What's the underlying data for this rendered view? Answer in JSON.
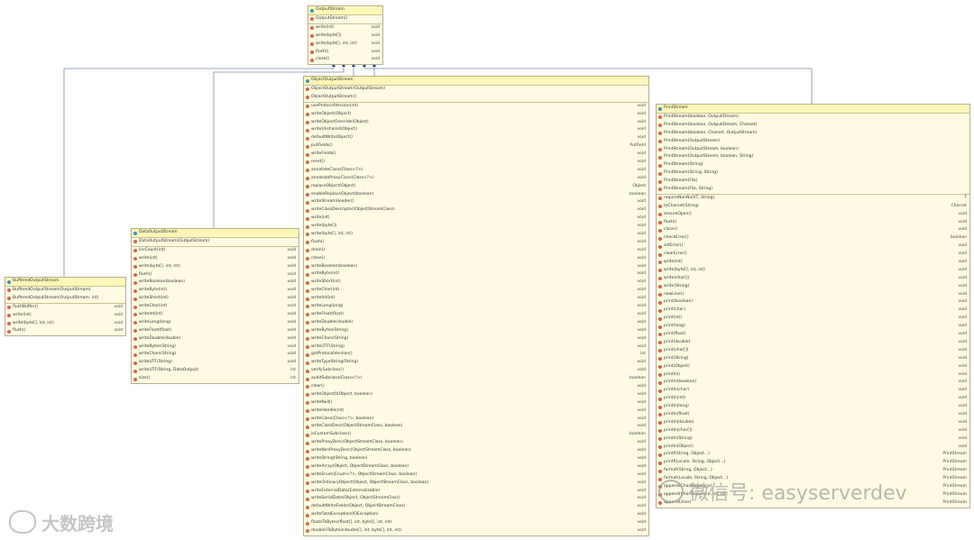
{
  "diagram": {
    "classes": {
      "output_stream": {
        "name": "OutputStream",
        "constructors": [
          "OutputStream()"
        ],
        "methods": [
          {
            "name": "write(int)",
            "ret": "void"
          },
          {
            "name": "write(byte[])",
            "ret": "void"
          },
          {
            "name": "write(byte[], int, int)",
            "ret": "void"
          },
          {
            "name": "flush()",
            "ret": "void"
          },
          {
            "name": "close()",
            "ret": "void"
          }
        ]
      },
      "object_output_stream": {
        "name": "ObjectOutputStream",
        "constructors": [
          "ObjectOutputStream(OutputStream)",
          "ObjectOutputStream()"
        ],
        "methods": [
          {
            "name": "useProtocolVersion(int)",
            "ret": "void"
          },
          {
            "name": "writeObject(Object)",
            "ret": "void"
          },
          {
            "name": "writeObjectOverride(Object)",
            "ret": "void"
          },
          {
            "name": "writeUnshared(Object)",
            "ret": "void"
          },
          {
            "name": "defaultWriteObject()",
            "ret": "void"
          },
          {
            "name": "putFields()",
            "ret": "PutField"
          },
          {
            "name": "writeFields()",
            "ret": "void"
          },
          {
            "name": "reset()",
            "ret": "void"
          },
          {
            "name": "annotateClass(Class<?>)",
            "ret": "void"
          },
          {
            "name": "annotateProxyClass(Class<?>)",
            "ret": "void"
          },
          {
            "name": "replaceObject(Object)",
            "ret": "Object"
          },
          {
            "name": "enableReplaceObject(boolean)",
            "ret": "boolean"
          },
          {
            "name": "writeStreamHeader()",
            "ret": "void"
          },
          {
            "name": "writeClassDescriptor(ObjectStreamClass)",
            "ret": "void"
          },
          {
            "name": "write(int)",
            "ret": "void"
          },
          {
            "name": "write(byte[])",
            "ret": "void"
          },
          {
            "name": "write(byte[], int, int)",
            "ret": "void"
          },
          {
            "name": "flush()",
            "ret": "void"
          },
          {
            "name": "drain()",
            "ret": "void"
          },
          {
            "name": "close()",
            "ret": "void"
          },
          {
            "name": "writeBoolean(boolean)",
            "ret": "void"
          },
          {
            "name": "writeByte(int)",
            "ret": "void"
          },
          {
            "name": "writeShort(int)",
            "ret": "void"
          },
          {
            "name": "writeChar(int)",
            "ret": "void"
          },
          {
            "name": "writeInt(int)",
            "ret": "void"
          },
          {
            "name": "writeLong(long)",
            "ret": "void"
          },
          {
            "name": "writeFloat(float)",
            "ret": "void"
          },
          {
            "name": "writeDouble(double)",
            "ret": "void"
          },
          {
            "name": "writeBytes(String)",
            "ret": "void"
          },
          {
            "name": "writeChars(String)",
            "ret": "void"
          },
          {
            "name": "writeUTF(String)",
            "ret": "void"
          },
          {
            "name": "getProtocolVersion()",
            "ret": "int"
          },
          {
            "name": "writeTypeString(String)",
            "ret": "void"
          },
          {
            "name": "verifySubclass()",
            "ret": "void"
          },
          {
            "name": "auditSubclass(Class<?>)",
            "ret": "boolean"
          },
          {
            "name": "clear()",
            "ret": "void"
          },
          {
            "name": "writeObject0(Object, boolean)",
            "ret": "void"
          },
          {
            "name": "writeNull()",
            "ret": "void"
          },
          {
            "name": "writeHandle(int)",
            "ret": "void"
          },
          {
            "name": "writeClass(Class<?>, boolean)",
            "ret": "void"
          },
          {
            "name": "writeClassDesc(ObjectStreamClass, boolean)",
            "ret": "void"
          },
          {
            "name": "isCustomSubclass()",
            "ret": "boolean"
          },
          {
            "name": "writeProxyDesc(ObjectStreamClass, boolean)",
            "ret": "void"
          },
          {
            "name": "writeNonProxyDesc(ObjectStreamClass, boolean)",
            "ret": "void"
          },
          {
            "name": "writeString(String, boolean)",
            "ret": "void"
          },
          {
            "name": "writeArray(Object, ObjectStreamClass, boolean)",
            "ret": "void"
          },
          {
            "name": "writeEnum(Enum<?>, ObjectStreamClass, boolean)",
            "ret": "void"
          },
          {
            "name": "writeOrdinaryObject(Object, ObjectStreamClass, boolean)",
            "ret": "void"
          },
          {
            "name": "writeExternalData(Externalizable)",
            "ret": "void"
          },
          {
            "name": "writeSerialData(Object, ObjectStreamClass)",
            "ret": "void"
          },
          {
            "name": "defaultWriteFields(Object, ObjectStreamClass)",
            "ret": "void"
          },
          {
            "name": "writeFatalException(IOException)",
            "ret": "void"
          },
          {
            "name": "floatsToBytes(float[], int, byte[], int, int)",
            "ret": "void"
          },
          {
            "name": "doublesToBytes(double[], int, byte[], int, int)",
            "ret": "void"
          }
        ]
      },
      "print_stream": {
        "name": "PrintStream",
        "constructors": [
          "PrintStream(boolean, OutputStream)",
          "PrintStream(boolean, OutputStream, Charset)",
          "PrintStream(boolean, Charset, OutputStream)",
          "PrintStream(OutputStream)",
          "PrintStream(OutputStream, boolean)",
          "PrintStream(OutputStream, boolean, String)",
          "PrintStream(String)",
          "PrintStream(String, String)",
          "PrintStream(File)",
          "PrintStream(File, String)"
        ],
        "methods": [
          {
            "name": "requireNonNull(T, String)",
            "ret": "T"
          },
          {
            "name": "toCharset(String)",
            "ret": "Charset"
          },
          {
            "name": "ensureOpen()",
            "ret": "void"
          },
          {
            "name": "flush()",
            "ret": "void"
          },
          {
            "name": "close()",
            "ret": "void"
          },
          {
            "name": "checkError()",
            "ret": "boolean"
          },
          {
            "name": "setError()",
            "ret": "void"
          },
          {
            "name": "clearError()",
            "ret": "void"
          },
          {
            "name": "write(int)",
            "ret": "void"
          },
          {
            "name": "write(byte[], int, int)",
            "ret": "void"
          },
          {
            "name": "write(char[])",
            "ret": "void"
          },
          {
            "name": "write(String)",
            "ret": "void"
          },
          {
            "name": "newLine()",
            "ret": "void"
          },
          {
            "name": "print(boolean)",
            "ret": "void"
          },
          {
            "name": "print(char)",
            "ret": "void"
          },
          {
            "name": "print(int)",
            "ret": "void"
          },
          {
            "name": "print(long)",
            "ret": "void"
          },
          {
            "name": "print(float)",
            "ret": "void"
          },
          {
            "name": "print(double)",
            "ret": "void"
          },
          {
            "name": "print(char[])",
            "ret": "void"
          },
          {
            "name": "print(String)",
            "ret": "void"
          },
          {
            "name": "print(Object)",
            "ret": "void"
          },
          {
            "name": "println()",
            "ret": "void"
          },
          {
            "name": "println(boolean)",
            "ret": "void"
          },
          {
            "name": "println(char)",
            "ret": "void"
          },
          {
            "name": "println(int)",
            "ret": "void"
          },
          {
            "name": "println(long)",
            "ret": "void"
          },
          {
            "name": "println(float)",
            "ret": "void"
          },
          {
            "name": "println(double)",
            "ret": "void"
          },
          {
            "name": "println(char[])",
            "ret": "void"
          },
          {
            "name": "println(String)",
            "ret": "void"
          },
          {
            "name": "println(Object)",
            "ret": "void"
          },
          {
            "name": "printf(String, Object...)",
            "ret": "PrintStream"
          },
          {
            "name": "printf(Locale, String, Object...)",
            "ret": "PrintStream"
          },
          {
            "name": "format(String, Object...)",
            "ret": "PrintStream"
          },
          {
            "name": "format(Locale, String, Object...)",
            "ret": "PrintStream"
          },
          {
            "name": "append(CharSequence)",
            "ret": "PrintStream"
          },
          {
            "name": "append(CharSequence, int, int)",
            "ret": "PrintStream"
          },
          {
            "name": "append(char)",
            "ret": "PrintStream"
          }
        ]
      },
      "data_output_stream": {
        "name": "DataOutputStream",
        "constructors": [
          "DataOutputStream(OutputStream)"
        ],
        "methods": [
          {
            "name": "incCount(int)",
            "ret": "void"
          },
          {
            "name": "write(int)",
            "ret": "void"
          },
          {
            "name": "write(byte[], int, int)",
            "ret": "void"
          },
          {
            "name": "flush()",
            "ret": "void"
          },
          {
            "name": "writeBoolean(boolean)",
            "ret": "void"
          },
          {
            "name": "writeByte(int)",
            "ret": "void"
          },
          {
            "name": "writeShort(int)",
            "ret": "void"
          },
          {
            "name": "writeChar(int)",
            "ret": "void"
          },
          {
            "name": "writeInt(int)",
            "ret": "void"
          },
          {
            "name": "writeLong(long)",
            "ret": "void"
          },
          {
            "name": "writeFloat(float)",
            "ret": "void"
          },
          {
            "name": "writeDouble(double)",
            "ret": "void"
          },
          {
            "name": "writeBytes(String)",
            "ret": "void"
          },
          {
            "name": "writeChars(String)",
            "ret": "void"
          },
          {
            "name": "writeUTF(String)",
            "ret": "void"
          },
          {
            "name": "writeUTF(String, DataOutput)",
            "ret": "int"
          },
          {
            "name": "size()",
            "ret": "int"
          }
        ]
      },
      "buffered_output_stream": {
        "name": "BufferedOutputStream",
        "constructors": [
          "BufferedOutputStream(OutputStream)",
          "BufferedOutputStream(OutputStream, int)"
        ],
        "methods": [
          {
            "name": "flushBuffer()",
            "ret": "void"
          },
          {
            "name": "write(int)",
            "ret": "void"
          },
          {
            "name": "write(byte[], int, int)",
            "ret": "void"
          },
          {
            "name": "flush()",
            "ret": "void"
          }
        ]
      }
    }
  },
  "watermarks": {
    "wechat": "微信号: easyserverdev",
    "logo": "大数跨境"
  },
  "colors": {
    "box_fill": "#fffbe3",
    "header_fill": "#fff7b8",
    "border": "#b4b08a",
    "link": "#7a8aa8",
    "arrow": "#1f3a8a",
    "method_icon": "#d9644d",
    "ctor_icon": "#3a8fc8"
  }
}
